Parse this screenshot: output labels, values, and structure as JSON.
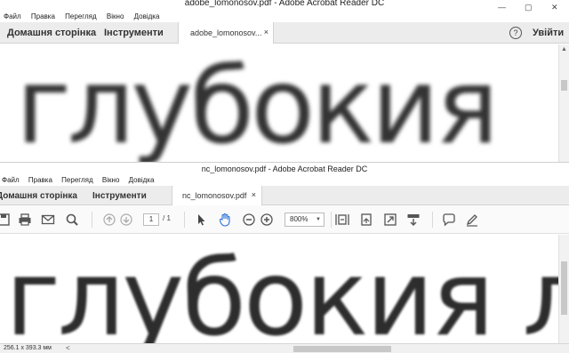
{
  "top_window": {
    "title": "adobe_lomonosov.pdf - Adobe Acrobat Reader DC",
    "menu": [
      "Файл",
      "Правка",
      "Перегляд",
      "Вікно",
      "Довідка"
    ],
    "tabs": {
      "home": "Домашня сторінка",
      "tools": "Інструменти",
      "document": "adobe_lomonosov...",
      "close": "×"
    },
    "help": "?",
    "sign_in": "Увійти",
    "page_text": "глубокия"
  },
  "bottom_window": {
    "title": "nc_lomonosov.pdf - Adobe Acrobat Reader DC",
    "menu": [
      "Файл",
      "Правка",
      "Перегляд",
      "Вікно",
      "Довідка"
    ],
    "tabs": {
      "home": "Домашня сторінка",
      "tools": "Інструменти",
      "document": "nc_lomonosov.pdf",
      "close": "×"
    },
    "toolbar": {
      "current_page": "1",
      "total_pages": "/ 1",
      "zoom": "800%",
      "icons": [
        "save-icon",
        "print-icon",
        "email-icon",
        "search-icon",
        "page-up-icon",
        "page-down-icon",
        "select-arrow-icon",
        "hand-icon",
        "zoom-out-icon",
        "zoom-in-icon",
        "fit-page-icon",
        "rotate-icon",
        "fullscreen-icon",
        "read-mode-icon",
        "comment-icon",
        "sign-icon"
      ]
    },
    "page_text": "глубокия л",
    "status": {
      "page_size": "256.1 x 393.3 мм",
      "scroll_left": "<"
    }
  }
}
